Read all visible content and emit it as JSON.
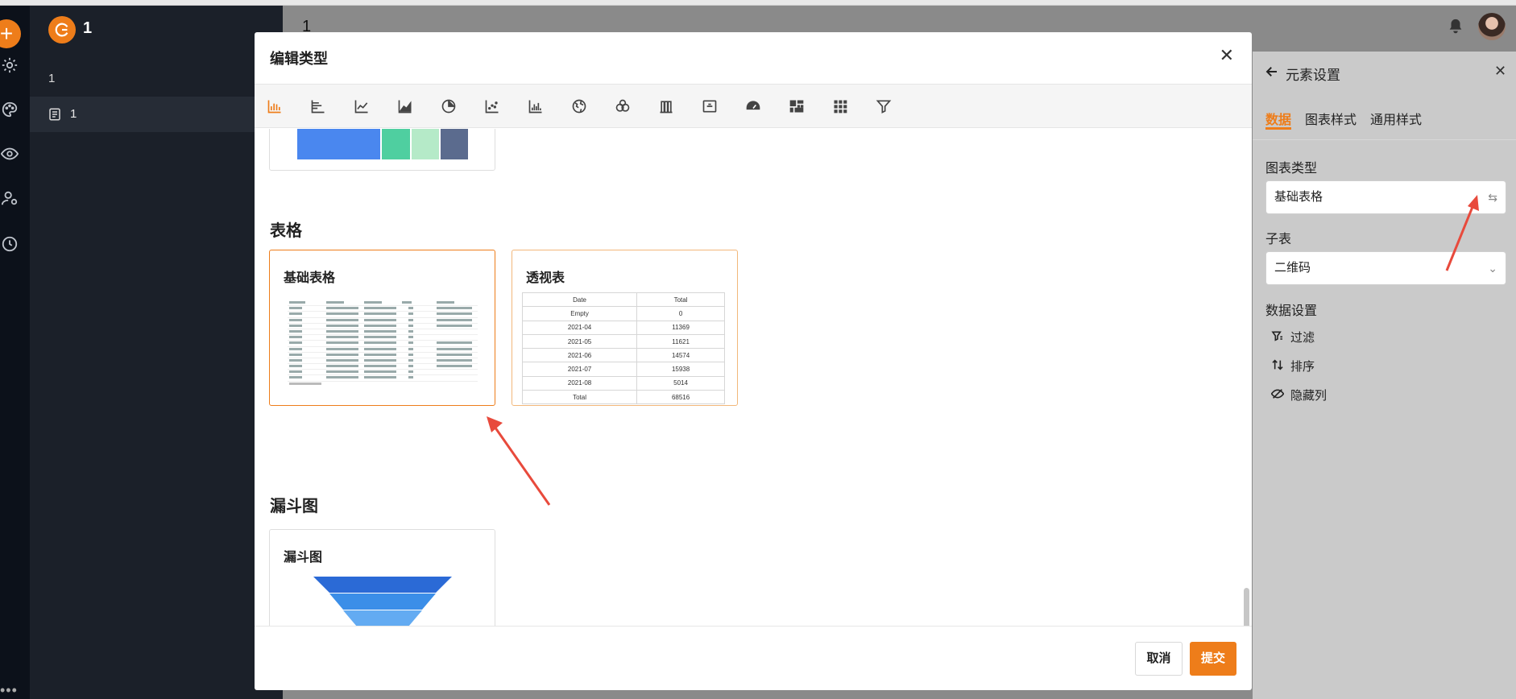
{
  "nav": {
    "app_name": "1",
    "item1": "1",
    "item2": "1"
  },
  "header": {
    "title": "1"
  },
  "right_panel": {
    "title": "元素设置",
    "tabs": [
      "数据",
      "图表样式",
      "通用样式"
    ],
    "chart_type_label": "图表类型",
    "chart_type_value": "基础表格",
    "subtable_label": "子表",
    "subtable_value": "二维码",
    "data_settings_label": "数据设置",
    "ops": [
      "过滤",
      "排序",
      "隐藏列"
    ]
  },
  "modal": {
    "title": "编辑类型",
    "toolbar_icons": [
      "bar-chart-icon",
      "horizontal-bar-icon",
      "line-chart-icon",
      "area-chart-icon",
      "pie-chart-icon",
      "scatter-chart-icon",
      "histogram-icon",
      "map-globe-icon",
      "radar-chart-icon",
      "column-grid-icon",
      "metric-card-icon",
      "gauge-icon",
      "treemap-icon",
      "table-grid-icon",
      "funnel-icon"
    ],
    "sections": {
      "table": {
        "title": "表格",
        "cards": [
          "基础表格",
          "透视表"
        ]
      },
      "funnel": {
        "title": "漏斗图",
        "cards": [
          "漏斗图"
        ]
      }
    },
    "pivot_preview": {
      "header": [
        "Date",
        "Total"
      ],
      "rows": [
        [
          "Empty",
          "0"
        ],
        [
          "2021-04",
          "11369"
        ],
        [
          "2021-05",
          "11621"
        ],
        [
          "2021-06",
          "14574"
        ],
        [
          "2021-07",
          "15938"
        ],
        [
          "2021-08",
          "5014"
        ],
        [
          "Total",
          "68516"
        ]
      ]
    },
    "cancel_label": "取消",
    "submit_label": "提交"
  },
  "colors": {
    "accent": "#ee7d1a",
    "funnel": [
      "#2b6ad6",
      "#3b8ee8",
      "#63abf2",
      "#92c7f7",
      "#c4e2fb"
    ]
  }
}
